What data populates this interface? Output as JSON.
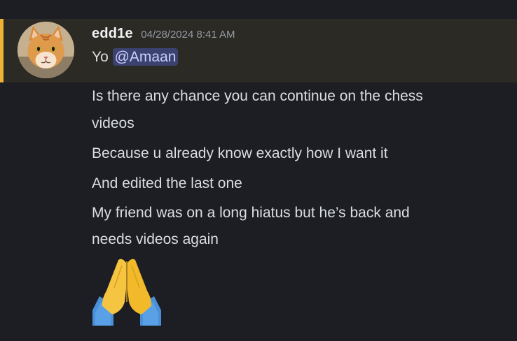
{
  "message": {
    "username": "edd1e",
    "timestamp": "04/28/2024 8:41 AM",
    "first_line_prefix": "Yo ",
    "mention": "@Amaan",
    "lines": [
      "Is there any chance you can continue on the chess",
      "videos",
      "Because u already know exactly how I want it",
      "And edited the last one",
      "My friend was on a long hiatus but he’s back and",
      "needs videos again"
    ],
    "emoji": "folded-hands",
    "avatar": "orange-cat"
  },
  "colors": {
    "background": "#1d1e23",
    "highlight": "#2b2a24",
    "highlight_bar": "#f0b232",
    "mention_bg": "#3c4270",
    "mention_text": "#c9cdfb",
    "timestamp": "#949ba4"
  }
}
